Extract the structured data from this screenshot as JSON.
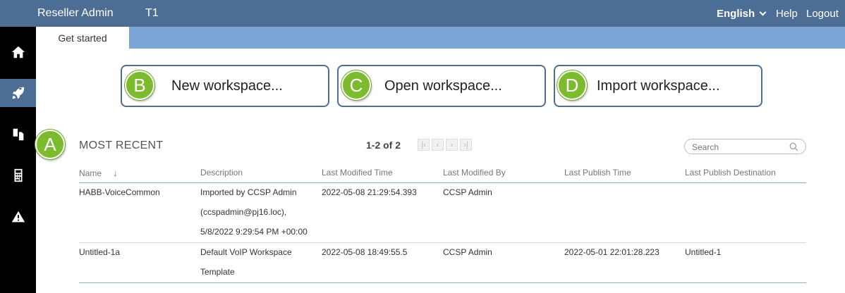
{
  "header": {
    "app_title": "Reseller Admin",
    "tenant": "T1",
    "language": "English",
    "help": "Help",
    "logout": "Logout"
  },
  "sidebar": {
    "items": [
      {
        "icon": "home-icon",
        "active": false
      },
      {
        "icon": "rocket-icon",
        "active": true
      },
      {
        "icon": "documents-icon",
        "active": false
      },
      {
        "icon": "calculator-icon",
        "active": false
      },
      {
        "icon": "warning-icon",
        "active": false
      }
    ]
  },
  "tabs": [
    {
      "label": "Get started",
      "active": true
    }
  ],
  "actions": [
    {
      "badge": "B",
      "label": "New workspace..."
    },
    {
      "badge": "C",
      "label": "Open workspace..."
    },
    {
      "badge": "D",
      "label": "Import workspace..."
    }
  ],
  "recent": {
    "badge": "A",
    "title": "MOST RECENT",
    "pager": "1-2 of 2",
    "search_placeholder": "Search",
    "columns": [
      "Name",
      "Description",
      "Last Modified Time",
      "Last Modified By",
      "Last Publish Time",
      "Last Publish Destination"
    ],
    "sort_indicator": "↓",
    "rows": [
      {
        "name": "HABB-VoiceCommon",
        "description": [
          "Imported by CCSP Admin",
          "(ccspadmin@pj16.loc),",
          "5/8/2022 9:29:54 PM +00:00"
        ],
        "modified_time": "2022-05-08 21:29:54.393",
        "modified_by": "CCSP Admin",
        "publish_time": "",
        "publish_destination": ""
      },
      {
        "name": "Untitled-1a",
        "description": [
          "Default VoIP Workspace",
          "Template"
        ],
        "modified_time": "2022-05-08 18:49:55.5",
        "modified_by": "CCSP Admin",
        "publish_time": "2022-05-01 22:01:28.223",
        "publish_destination": "Untitled-1"
      }
    ]
  },
  "colors": {
    "topbar": "#4d6e94",
    "tabstrip": "#7aa5d4",
    "badge_green": "#7dbb2e",
    "sidebar": "#000000"
  }
}
